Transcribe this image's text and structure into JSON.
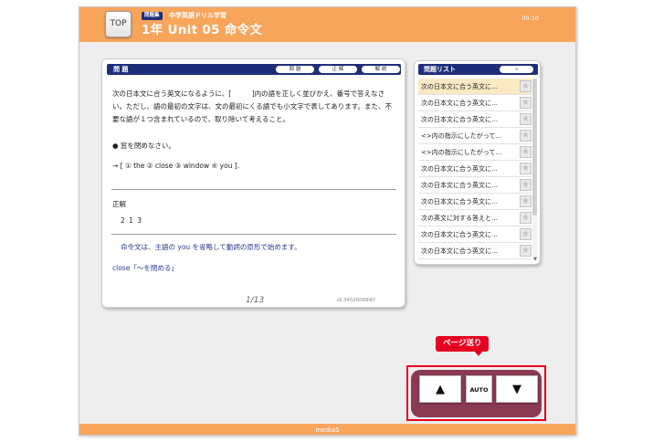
{
  "header": {
    "top_button": "TOP",
    "badge": "問題集",
    "subject": "中学英語ドリル学習",
    "title": "1年 Unit 05 命令文",
    "timer": "00:10"
  },
  "question_panel": {
    "label": "問 題",
    "tabs": [
      "問 題",
      "正 解",
      "解 説"
    ],
    "instruction": "次の日本文に合う英文になるように、[　　　]内の語を正しく並びかえ、番号で答えなさい。ただし、語の最初の文字は、文の最初にくる語でも小文字で表してあります。また、不要な語が１つ含まれているので、取り除いて考えること。",
    "prompt": "● 窓を閉めなさい。",
    "choices": "→ [ ① the ② close ③ window ④ you ].",
    "answer_label": "正解",
    "answer": "2 1 3",
    "explanation_1": "命令文は、主語の you を省略して動詞の原形で始めます。",
    "explanation_2": "close「〜を閉める」",
    "page": "1/13",
    "question_id": "id.3402000840"
  },
  "list_panel": {
    "label": "問題リスト",
    "toggle": "»",
    "items": [
      "次の日本文に合う英文に…",
      "次の日本文に合う英文に…",
      "次の日本文に合う英文に…",
      "<>内の指示にしたがって…",
      "<>内の指示にしたがって…",
      "次の日本文に合う英文に…",
      "次の日本文に合う英文に…",
      "次の日本文に合う英文に…",
      "次の英文に対する答えと…",
      "次の日本文に合う英文に…",
      "次の日本文に合う英文に…"
    ],
    "star": "★",
    "scroll_down": "▼"
  },
  "nav": {
    "callout": "ページ送り",
    "up": "▲",
    "auto": "AUTO",
    "down": "▼"
  },
  "footer": {
    "brand": "media5"
  }
}
